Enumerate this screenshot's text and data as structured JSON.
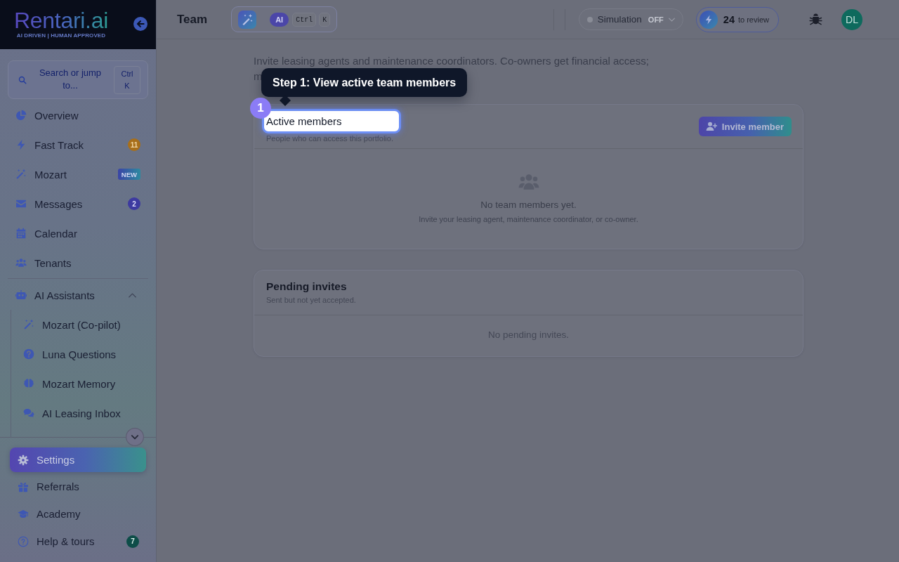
{
  "sidebar": {
    "logo": {
      "name": "Rentari.ai",
      "tagline": "AI DRIVEN | HUMAN APPROVED"
    },
    "search": {
      "placeholder": "Search or jump to...",
      "shortcut": "Ctrl K"
    },
    "items": [
      {
        "label": "Overview",
        "selected": false
      },
      {
        "label": "Fast Track",
        "selected": false,
        "badge": {
          "text": "11",
          "kind": "warning"
        }
      },
      {
        "label": "Mozart",
        "selected": false,
        "badge": {
          "text": "NEW",
          "kind": "new"
        }
      },
      {
        "label": "Messages",
        "selected": false,
        "badge": {
          "text": "2",
          "kind": "count"
        }
      },
      {
        "label": "Calendar",
        "selected": false
      },
      {
        "label": "Tenants",
        "selected": false
      }
    ],
    "groups": [
      {
        "label": "AI Assistants",
        "expanded": true,
        "children": [
          {
            "label": "Mozart (Co-pilot)",
            "selected": false
          },
          {
            "label": "Luna Questions",
            "selected": false
          },
          {
            "label": "Mozart Memory",
            "selected": false
          },
          {
            "label": "AI Leasing Inbox",
            "selected": false
          }
        ]
      }
    ],
    "bottom_items": [
      {
        "label": "Settings",
        "selected": true
      },
      {
        "label": "Referrals",
        "selected": false
      },
      {
        "label": "Academy",
        "selected": false
      },
      {
        "label": "Help & tours",
        "selected": false,
        "badge": {
          "text": "7",
          "kind": "success"
        }
      }
    ]
  },
  "topbar": {
    "title": "Team",
    "command_bar": {
      "ai_label": "AI",
      "keys": [
        "Ctrl",
        "K"
      ]
    },
    "simulation": {
      "label": "Simulation",
      "value": "OFF",
      "on": false
    },
    "review": {
      "count": "24",
      "label": "to review"
    },
    "avatar": "DL"
  },
  "page": {
    "description_lines": [
      "Invite leasing agents and maintenance coordinators. Co-owners get financial access;",
      "m"
    ],
    "sections": [
      {
        "title": "Active members",
        "subtitle": "People who can access this portfolio.",
        "highlighted": true,
        "action": "Invite member",
        "empty": {
          "kind": "illustrated",
          "title": "No team members yet.",
          "text": "Invite your leasing agent, maintenance coordinator, or co-owner."
        }
      },
      {
        "title": "Pending invites",
        "subtitle": "Sent but not yet accepted.",
        "highlighted": false,
        "empty": {
          "kind": "plain",
          "text": "No pending invites."
        }
      }
    ]
  },
  "tour": {
    "step": "1",
    "tooltip": "Step 1: View active team members"
  }
}
